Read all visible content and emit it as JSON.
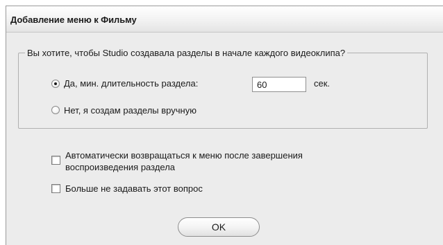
{
  "window": {
    "title": "Добавление меню к Фильму"
  },
  "group": {
    "legend": "Вы хотите, чтобы Studio создавала разделы в начале каждого видеоклипа?",
    "option_auto": {
      "label": "Да, мин. длительность раздела:",
      "selected": true
    },
    "min_duration": {
      "value": "60",
      "unit": "сек."
    },
    "option_manual": {
      "label": "Нет, я создам разделы вручную",
      "selected": false
    }
  },
  "checkboxes": {
    "return_to_menu": {
      "label_line1": "Автоматически возвращаться к меню после завершения",
      "label_line2": "воспроизведения раздела",
      "checked": false
    },
    "dont_ask": {
      "label": "Больше не задавать этот вопрос",
      "checked": false
    }
  },
  "buttons": {
    "ok_label": "OK"
  }
}
